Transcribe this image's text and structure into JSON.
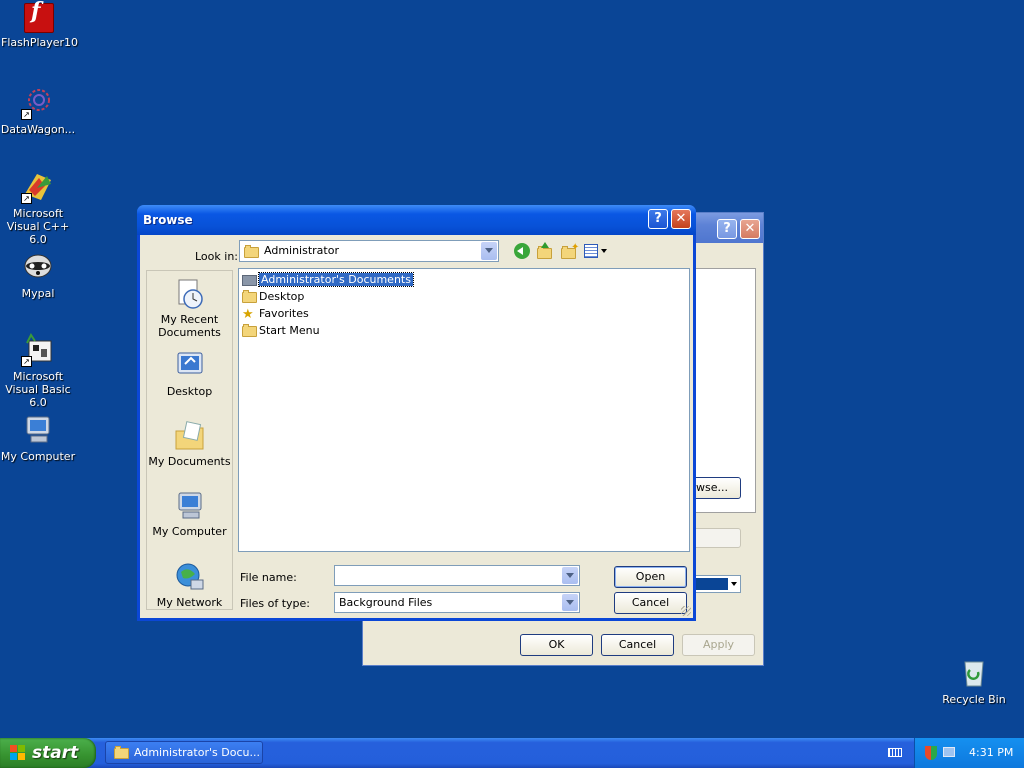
{
  "desktop": {
    "icons": [
      {
        "label": "FlashPlayer10",
        "icon": "flash-player-icon"
      },
      {
        "label": "DataWagon...",
        "icon": "datawagon-icon"
      },
      {
        "label": "Microsoft Visual C++ 6.0",
        "icon": "visual-cpp-icon"
      },
      {
        "label": "Mypal",
        "icon": "mypal-icon"
      },
      {
        "label": "Microsoft Visual Basic 6.0",
        "icon": "visual-basic-icon"
      },
      {
        "label": "My Computer",
        "icon": "my-computer-icon"
      },
      {
        "label": "Recycle Bin",
        "icon": "recycle-bin-icon"
      }
    ],
    "background_color": "#0a4596"
  },
  "background_dialog": {
    "help_label": "?",
    "close_label": "✕",
    "browse_button_label": "wse...",
    "ok_label": "OK",
    "cancel_label": "Cancel",
    "apply_label": "Apply"
  },
  "browse_dialog": {
    "title": "Browse",
    "help_label": "?",
    "close_label": "✕",
    "look_in_label": "Look in:",
    "look_in_value": "Administrator",
    "places": [
      {
        "label": "My Recent Documents",
        "icon": "recent-documents-icon"
      },
      {
        "label": "Desktop",
        "icon": "desktop-icon"
      },
      {
        "label": "My Documents",
        "icon": "my-documents-icon"
      },
      {
        "label": "My Computer",
        "icon": "my-computer-icon"
      },
      {
        "label": "My Network",
        "icon": "my-network-icon"
      }
    ],
    "files": [
      {
        "name": "Administrator's Documents",
        "icon": "folder-icon",
        "selected": true
      },
      {
        "name": "Desktop",
        "icon": "folder-icon",
        "selected": false
      },
      {
        "name": "Favorites",
        "icon": "favorites-star-icon",
        "selected": false
      },
      {
        "name": "Start Menu",
        "icon": "folder-icon",
        "selected": false
      }
    ],
    "file_name_label": "File name:",
    "file_name_value": "",
    "files_of_type_label": "Files of type:",
    "files_of_type_value": "Background Files",
    "open_label": "Open",
    "cancel_label": "Cancel"
  },
  "taskbar": {
    "start_label": "start",
    "task_label": "Administrator's Docu...",
    "clock": "4:31 PM"
  }
}
